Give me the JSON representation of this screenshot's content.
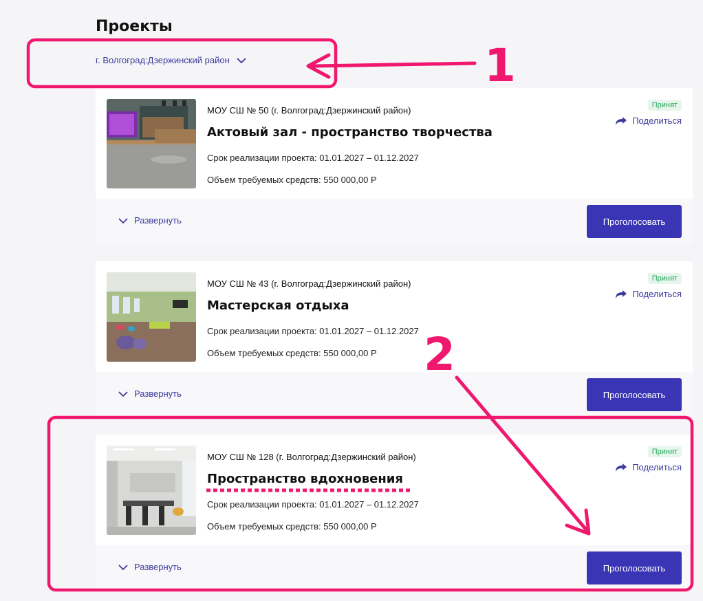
{
  "page": {
    "title": "Проекты"
  },
  "filter": {
    "label": "г. Волгоград:Дзержинский район"
  },
  "projects": [
    {
      "school": "МОУ СШ № 50 (г. Волгоград:Дзержинский район)",
      "title": "Актовый зал - пространство творчества",
      "term": "Срок реализации проекта: 01.01.2027 – 01.12.2027",
      "funds": "Объем требуемых средств: 550 000,00 Р",
      "status": "Принят",
      "share_label": "Поделиться",
      "expand_label": "Развернуть",
      "vote_label": "Проголосовать"
    },
    {
      "school": "МОУ СШ № 43 (г. Волгоград:Дзержинский район)",
      "title": "Мастерская отдыха",
      "term": "Срок реализации проекта: 01.01.2027 – 01.12.2027",
      "funds": "Объем требуемых средств: 550 000,00 Р",
      "status": "Принят",
      "share_label": "Поделиться",
      "expand_label": "Развернуть",
      "vote_label": "Проголосовать"
    },
    {
      "school": "МОУ СШ № 128 (г. Волгоград:Дзержинский район)",
      "title": "Пространство вдохновения",
      "term": "Срок реализации проекта: 01.01.2027 – 01.12.2027",
      "funds": "Объем требуемых средств: 550 000,00 Р",
      "status": "Принят",
      "share_label": "Поделиться",
      "expand_label": "Развернуть",
      "vote_label": "Проголосовать"
    }
  ],
  "annotations": {
    "marker_1": "1",
    "marker_2": "2"
  },
  "colors": {
    "accent": "#3a35b4",
    "link": "#3d3a9e",
    "status_green": "#27a55a",
    "annotation": "#f0186e"
  }
}
